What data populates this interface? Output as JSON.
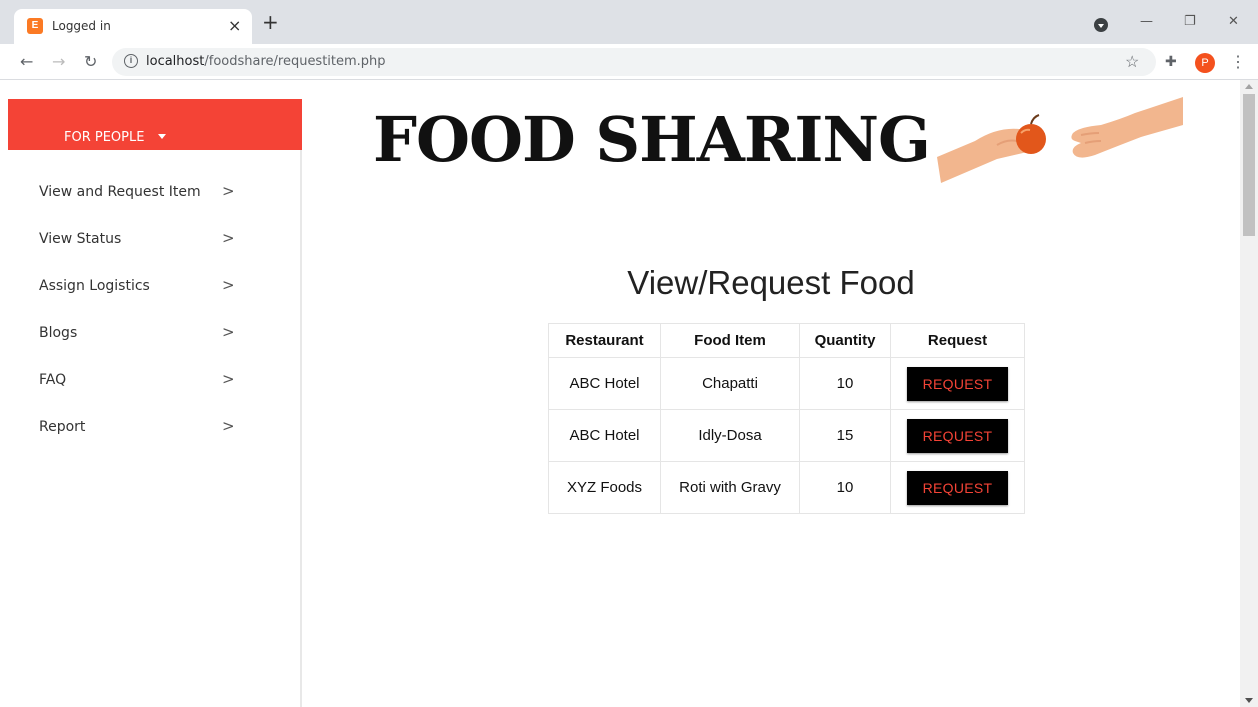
{
  "browser": {
    "tab_title": "Logged in",
    "tab_favicon_text": "E",
    "tab_close": "×",
    "new_tab": "+",
    "url_host": "localhost",
    "url_path": "/foodshare/requestitem.php",
    "avatar_letter": "P",
    "icons": [
      "back-icon",
      "forward-icon",
      "reload-icon",
      "info-icon",
      "star-icon",
      "extensions-icon",
      "menu-icon"
    ]
  },
  "sidebar": {
    "header_label": "FOR PEOPLE",
    "accent_color": "#f44336",
    "items": [
      {
        "label": "View and Request Item"
      },
      {
        "label": "View Status"
      },
      {
        "label": "Assign Logistics"
      },
      {
        "label": "Blogs"
      },
      {
        "label": "FAQ"
      },
      {
        "label": "Report"
      }
    ]
  },
  "main": {
    "brand_title": "FOOD SHARING",
    "section_title": "View/Request Food",
    "table": {
      "headers": [
        "Restaurant",
        "Food Item",
        "Quantity",
        "Request"
      ],
      "rows": [
        {
          "restaurant": "ABC Hotel",
          "item": "Chapatti",
          "quantity": "10",
          "button": "REQUEST"
        },
        {
          "restaurant": "ABC Hotel",
          "item": "Idly-Dosa",
          "quantity": "15",
          "button": "REQUEST"
        },
        {
          "restaurant": "XYZ Foods",
          "item": "Roti with Gravy",
          "quantity": "10",
          "button": "REQUEST"
        }
      ]
    }
  }
}
